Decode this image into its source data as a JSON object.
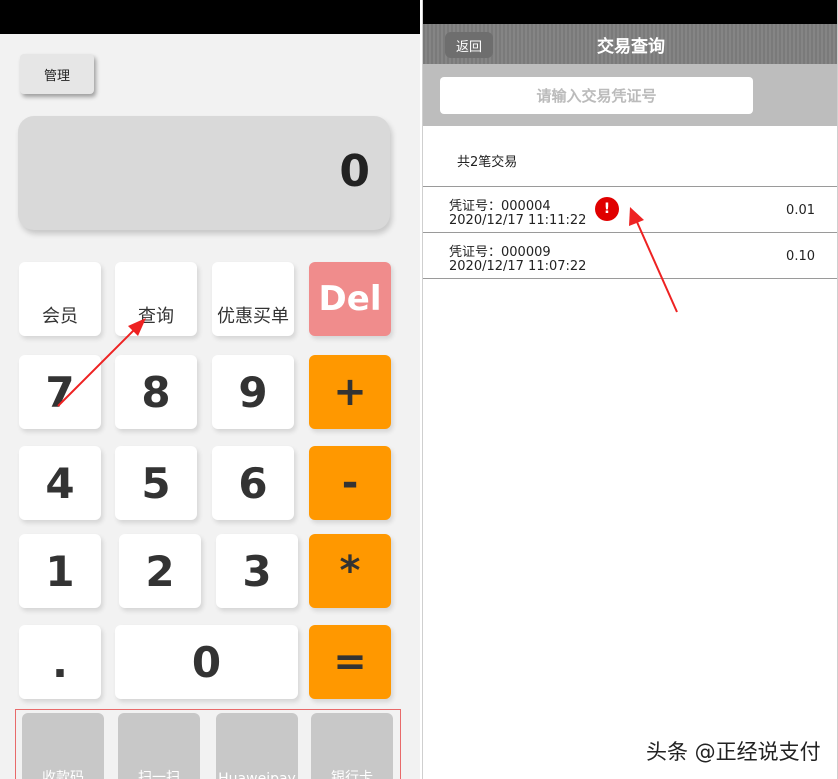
{
  "calculator": {
    "manage_label": "管理",
    "display_value": "0",
    "function_keys": [
      "会员",
      "查询",
      "优惠买单"
    ],
    "del_label": "Del",
    "digit_rows": [
      [
        "7",
        "8",
        "9"
      ],
      [
        "4",
        "5",
        "6"
      ],
      [
        "1",
        "2",
        "3"
      ]
    ],
    "operators": [
      "+",
      "-",
      "*",
      "="
    ],
    "dot_label": ".",
    "zero_label": "0",
    "payment_methods": [
      "收款码",
      "扫一扫",
      "Huaweipay",
      "银行卡"
    ],
    "colors": {
      "operator": "#ff9800",
      "del": "#f08c8c",
      "payment": "#c8c8c8"
    }
  },
  "transactions": {
    "back_label": "返回",
    "title": "交易查询",
    "search_placeholder": "请输入交易凭证号",
    "count_text": "共2笔交易",
    "items": [
      {
        "voucher": "凭证号：000004",
        "time": "2020/12/17  11:11:22",
        "amount": "0.01",
        "alert": "!"
      },
      {
        "voucher": "凭证号：000009",
        "time": "2020/12/17  11:07:22",
        "amount": "0.10"
      }
    ],
    "alert_icon": "exclamation-circle-icon",
    "alert_color": "#e00000"
  },
  "watermark": "头条 @正经说支付"
}
